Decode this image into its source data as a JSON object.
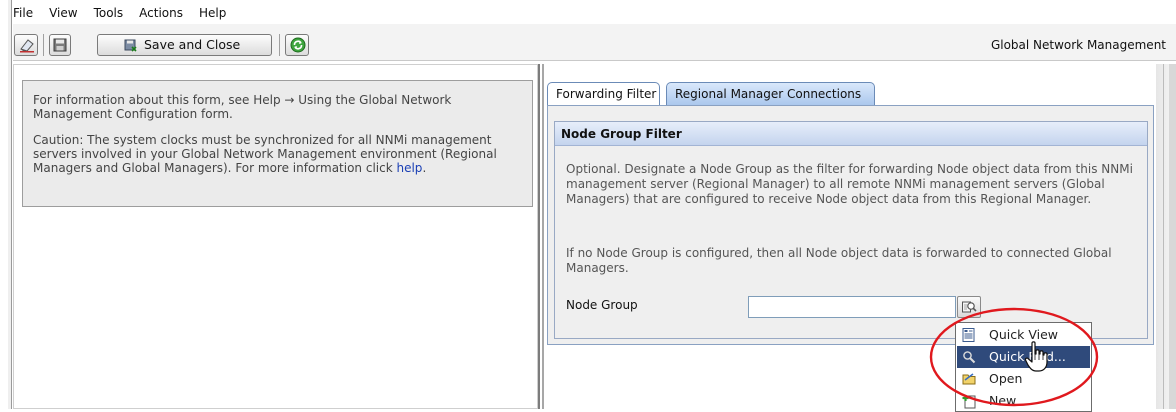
{
  "menubar": {
    "items": [
      "File",
      "View",
      "Tools",
      "Actions",
      "Help"
    ]
  },
  "toolbar": {
    "save_close_label": "Save and Close",
    "app_title": "Global Network Management"
  },
  "left_panel": {
    "info_text_prefix": "For information about this form, see Help → Using the Global Network Management Configuration form.",
    "caution_text": "Caution: The system clocks must be synchronized for all NNMi management servers involved in your Global Network Management environment (Regional Managers and Global Managers). For more information click ",
    "help_link": "help",
    "caution_suffix": "."
  },
  "tabs": {
    "forwarding_filter": "Forwarding Filter",
    "regional_manager_connections": "Regional Manager Connections"
  },
  "node_group_filter": {
    "header": "Node Group Filter",
    "description_1": "Optional. Designate a Node Group as the filter for forwarding Node object data from this NNMi management server (Regional Manager) to all remote NNMi management servers (Global Managers) that are configured to receive Node object data from this Regional Manager.",
    "description_2": "If no Node Group is configured, then all Node object data is forwarded to connected Global Managers.",
    "node_group_label": "Node Group",
    "node_group_value": ""
  },
  "lookup_menu": {
    "items": [
      "Quick View",
      "Quick Find...",
      "Open",
      "New"
    ],
    "selected": "Quick Find..."
  },
  "colors": {
    "highlight_ellipse": "#e0191e",
    "menu_selected_bg": "#2f4a7b",
    "link": "#1a3fb5"
  }
}
